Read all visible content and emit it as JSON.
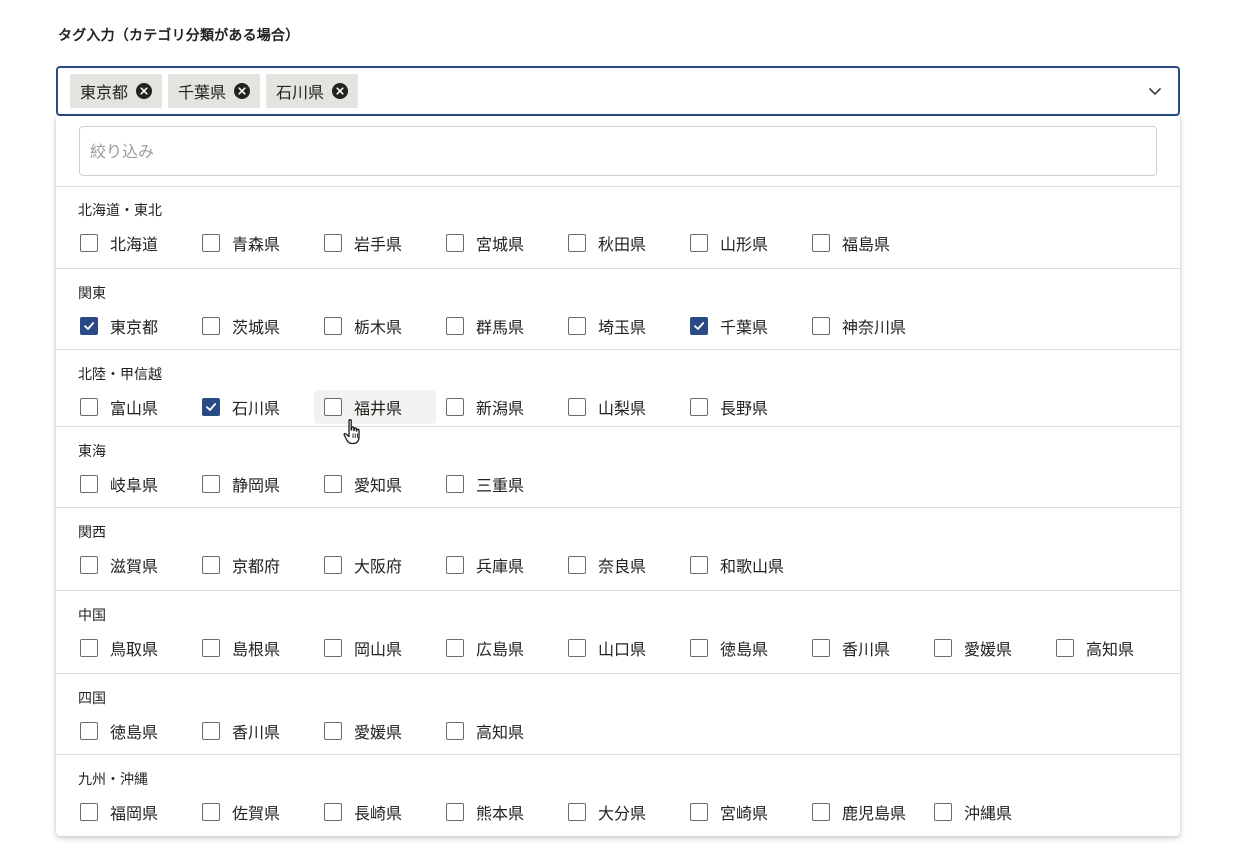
{
  "field": {
    "label": "タグ入力（カテゴリ分類がある場合）"
  },
  "tags": [
    {
      "label": "東京都"
    },
    {
      "label": "千葉県"
    },
    {
      "label": "石川県"
    }
  ],
  "filter": {
    "placeholder": "絞り込み",
    "value": ""
  },
  "groups": [
    {
      "title": "北海道・東北",
      "options": [
        {
          "label": "北海道",
          "checked": false
        },
        {
          "label": "青森県",
          "checked": false
        },
        {
          "label": "岩手県",
          "checked": false
        },
        {
          "label": "宮城県",
          "checked": false
        },
        {
          "label": "秋田県",
          "checked": false
        },
        {
          "label": "山形県",
          "checked": false
        },
        {
          "label": "福島県",
          "checked": false
        }
      ]
    },
    {
      "title": "関東",
      "options": [
        {
          "label": "東京都",
          "checked": true
        },
        {
          "label": "茨城県",
          "checked": false
        },
        {
          "label": "栃木県",
          "checked": false
        },
        {
          "label": "群馬県",
          "checked": false
        },
        {
          "label": "埼玉県",
          "checked": false
        },
        {
          "label": "千葉県",
          "checked": true
        },
        {
          "label": "神奈川県",
          "checked": false
        }
      ]
    },
    {
      "title": "北陸・甲信越",
      "options": [
        {
          "label": "富山県",
          "checked": false
        },
        {
          "label": "石川県",
          "checked": true
        },
        {
          "label": "福井県",
          "checked": false,
          "hovered": true
        },
        {
          "label": "新潟県",
          "checked": false
        },
        {
          "label": "山梨県",
          "checked": false
        },
        {
          "label": "長野県",
          "checked": false
        }
      ]
    },
    {
      "title": "東海",
      "options": [
        {
          "label": "岐阜県",
          "checked": false
        },
        {
          "label": "静岡県",
          "checked": false
        },
        {
          "label": "愛知県",
          "checked": false
        },
        {
          "label": "三重県",
          "checked": false
        }
      ]
    },
    {
      "title": "関西",
      "options": [
        {
          "label": "滋賀県",
          "checked": false
        },
        {
          "label": "京都府",
          "checked": false
        },
        {
          "label": "大阪府",
          "checked": false
        },
        {
          "label": "兵庫県",
          "checked": false
        },
        {
          "label": "奈良県",
          "checked": false
        },
        {
          "label": "和歌山県",
          "checked": false
        }
      ]
    },
    {
      "title": "中国",
      "options": [
        {
          "label": "鳥取県",
          "checked": false
        },
        {
          "label": "島根県",
          "checked": false
        },
        {
          "label": "岡山県",
          "checked": false
        },
        {
          "label": "広島県",
          "checked": false
        },
        {
          "label": "山口県",
          "checked": false
        },
        {
          "label": "徳島県",
          "checked": false
        },
        {
          "label": "香川県",
          "checked": false
        },
        {
          "label": "愛媛県",
          "checked": false
        },
        {
          "label": "高知県",
          "checked": false
        }
      ]
    },
    {
      "title": "四国",
      "options": [
        {
          "label": "徳島県",
          "checked": false
        },
        {
          "label": "香川県",
          "checked": false
        },
        {
          "label": "愛媛県",
          "checked": false
        },
        {
          "label": "高知県",
          "checked": false
        }
      ]
    },
    {
      "title": "九州・沖縄",
      "options": [
        {
          "label": "福岡県",
          "checked": false
        },
        {
          "label": "佐賀県",
          "checked": false
        },
        {
          "label": "長崎県",
          "checked": false
        },
        {
          "label": "熊本県",
          "checked": false
        },
        {
          "label": "大分県",
          "checked": false
        },
        {
          "label": "宮崎県",
          "checked": false
        },
        {
          "label": "鹿児島県",
          "checked": false
        },
        {
          "label": "沖縄県",
          "checked": false
        }
      ]
    }
  ],
  "icons": {
    "tag_remove": "close-circle-icon",
    "dropdown_toggle": "chevron-down-icon",
    "checkbox_check": "check-icon",
    "cursor": "hand-pointer-icon"
  },
  "colors": {
    "accent": "#2a4a86",
    "text": "#23221f",
    "tag_background": "#e3e3e0",
    "divider": "#dcdcd9",
    "hover_background": "#f2f2f0"
  }
}
